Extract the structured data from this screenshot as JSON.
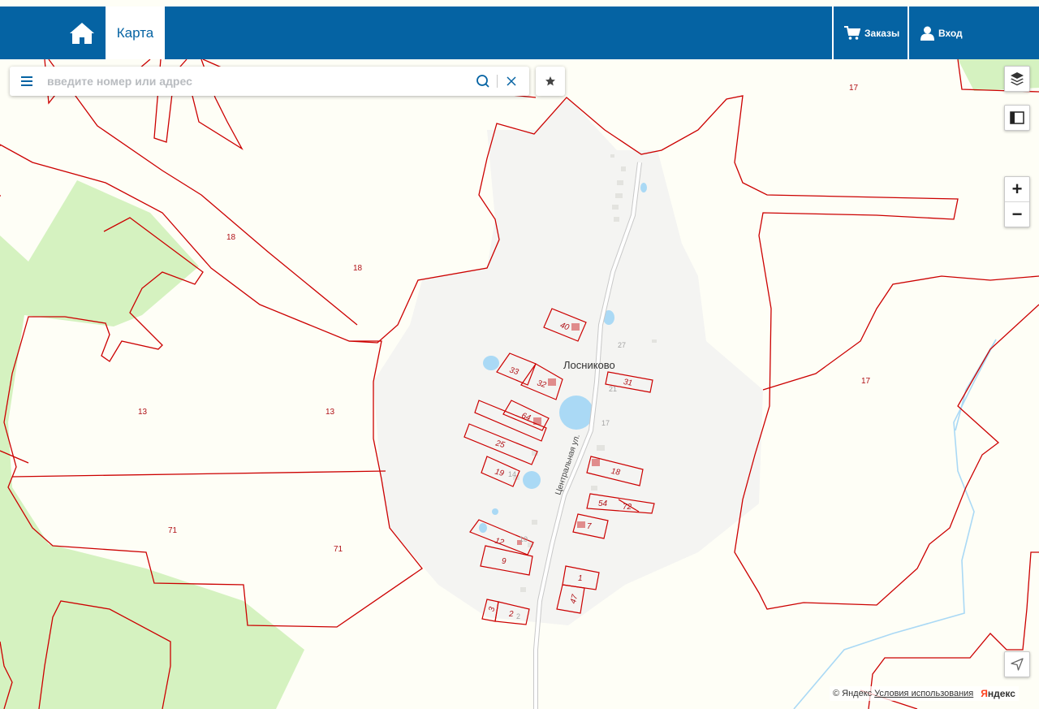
{
  "header": {
    "home_icon": "home-icon",
    "tab_map": "Карта",
    "orders_label": "Заказы",
    "orders_icon": "cart-icon",
    "login_label": "Вход",
    "login_icon": "user-icon"
  },
  "search": {
    "placeholder": "введите номер или адрес",
    "menu_icon": "hamburger-icon",
    "search_icon": "search-icon",
    "clear_icon": "close-icon"
  },
  "favorites": {
    "icon": "star-icon"
  },
  "controls": {
    "layers_icon": "layers-icon",
    "ruler_icon": "ruler-icon",
    "zoom_in": "+",
    "zoom_out": "−",
    "locate_icon": "navigation-arrow-icon"
  },
  "map": {
    "village_name": "Лосниково",
    "street_name": "Центральная ул.",
    "zone_labels": [
      "17",
      "17",
      "18",
      "18",
      "13",
      "13",
      "71",
      "71"
    ],
    "lot_labels": [
      "40",
      "33",
      "32",
      "31",
      "64",
      "25",
      "19",
      "18",
      "54",
      "72",
      "7",
      "12",
      "9",
      "1",
      "47",
      "3",
      "2"
    ],
    "house_numbers": [
      "27",
      "21",
      "17",
      "14",
      "10",
      "2"
    ],
    "colors": {
      "background": "#fefef6",
      "forest": "#d5f2c0",
      "settlement": "#f4f4f2",
      "boundary": "#cc0000",
      "water": "#aad9f5",
      "header": "#0563a3"
    }
  },
  "attribution": {
    "copyright": "© Яндекс",
    "terms": "Условия использования",
    "brand_first": "Я",
    "brand_rest": "ндекс"
  }
}
